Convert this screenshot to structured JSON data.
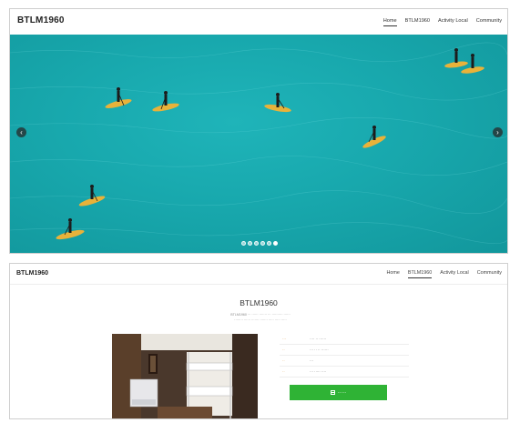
{
  "site": {
    "brand": "BTLM1960"
  },
  "nav": {
    "items": [
      "Home",
      "BTLM1960",
      "Activity Local",
      "Community"
    ],
    "active": "Home"
  },
  "slider": {
    "prev_icon": "chevron-left-icon",
    "next_icon": "chevron-right-icon",
    "slide_count": 6,
    "active_index": 5
  },
  "detail_page": {
    "brand": "BTLM1960",
    "nav": {
      "items": [
        "Home",
        "BTLM1960",
        "Activity Local",
        "Community"
      ],
      "active": "BTLM1960"
    },
    "title": "BTLM1960",
    "description": [
      "BTLM1960 ··· ······ ······· ··· ·········· ······",
      "········ ······ ······· ······· ····· ····· ·····"
    ],
    "info_rows": [
      {
        "label": "···",
        "value": "···· ·· ······"
      },
      {
        "label": "··",
        "value": "··· ·· ·· ······"
      },
      {
        "label": "··",
        "value": "···"
      },
      {
        "label": "··",
        "value": "··· ····· ····"
      }
    ],
    "reserve_button": {
      "icon": "calendar-icon",
      "label": "······"
    }
  },
  "colors": {
    "sea": "#18a8ad",
    "button": "#2fb335",
    "info_label": "#d68d2b"
  }
}
